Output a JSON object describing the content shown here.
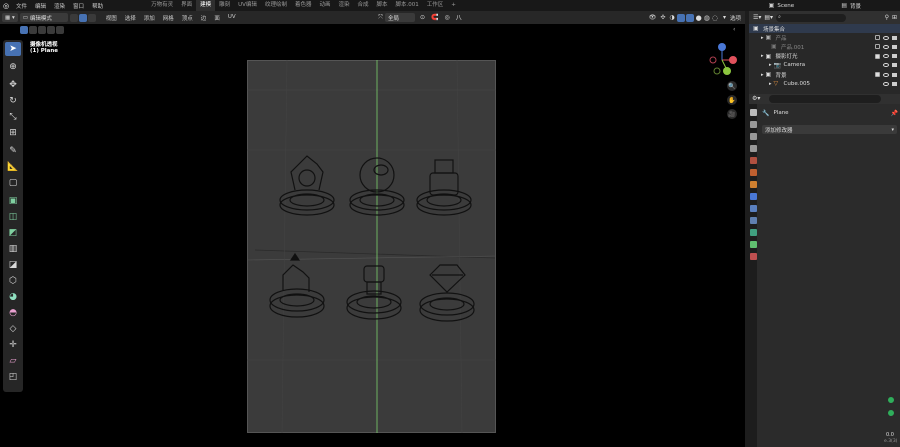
{
  "menubar": {
    "items": [
      "文件",
      "编辑",
      "渲染",
      "窗口",
      "帮助"
    ],
    "workspaces": [
      "万物有灵",
      "界面",
      "建模",
      "雕刻",
      "UV编辑",
      "纹理绘制",
      "着色器",
      "动画",
      "渲染",
      "合成",
      "脚本",
      "脚本.001",
      "工作区"
    ],
    "active_workspace": "建模",
    "add_tab": "+",
    "scene_name": "Scene",
    "view_layer": "背景"
  },
  "viewport_header": {
    "mode": "编辑模式",
    "menus": [
      "视图",
      "选择",
      "添加",
      "网格",
      "顶点",
      "边",
      "面",
      "UV"
    ],
    "transform_orientation": "全局",
    "snap_symbol": "八",
    "overlay_label": "选项"
  },
  "viewport_overlay": {
    "camera_title": "摄像机透视",
    "object_name": "(1) Plane"
  },
  "outliner": {
    "search_placeholder": "",
    "rows": [
      {
        "label": "场景集合",
        "indent": 0
      },
      {
        "label": "产品",
        "indent": 1
      },
      {
        "label": "产品.001",
        "indent": 2
      },
      {
        "label": "摄影灯光",
        "indent": 1
      },
      {
        "label": "Camera",
        "indent": 2
      },
      {
        "label": "背景",
        "indent": 1
      },
      {
        "label": "Cube.005",
        "indent": 2
      }
    ]
  },
  "properties": {
    "object_name": "Plane",
    "add_modifier": "添加修改器"
  },
  "status": {
    "value1": "0.0",
    "value2": "e.3(3)"
  },
  "colors": {
    "accent_blue": "#4772b3",
    "green_axis": "#7bd06b",
    "red_axis": "#e0515c",
    "y_axis": "#8cc63f",
    "plane_gray": "#3b3b3b"
  }
}
